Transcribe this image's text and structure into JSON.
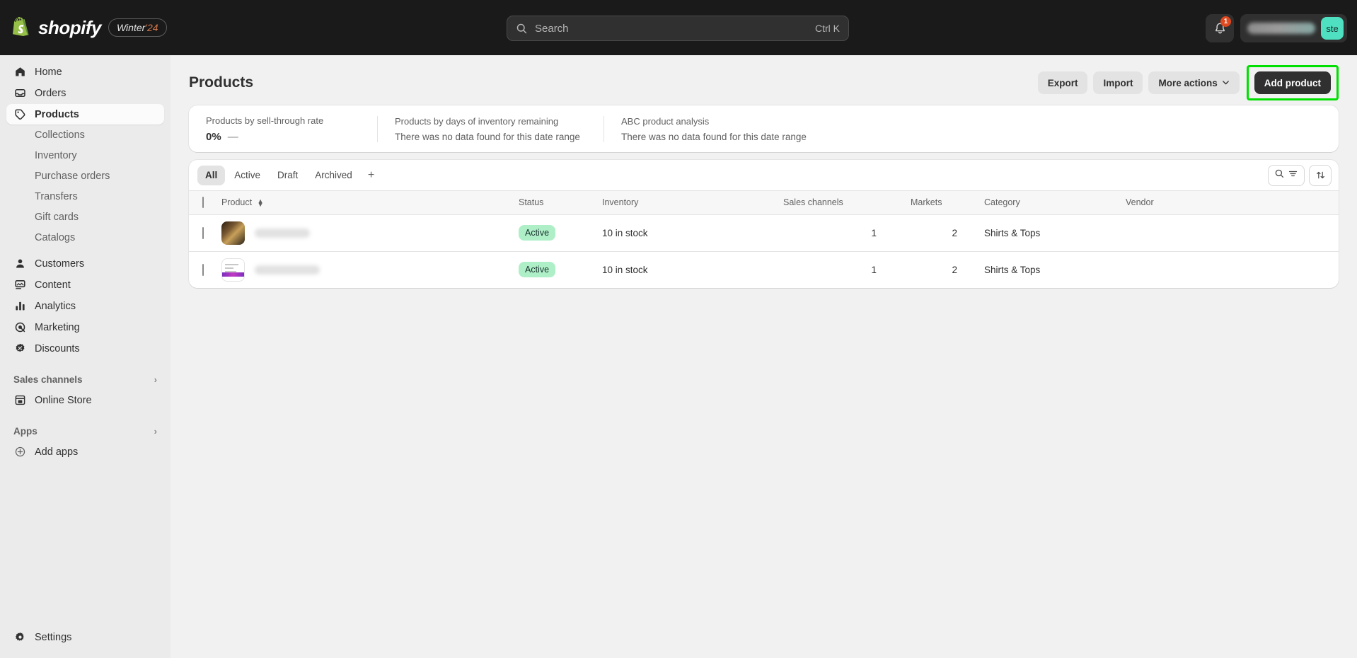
{
  "topbar": {
    "brand_name": "shopify",
    "version_prefix": "Winter ",
    "version_year": "'24",
    "search_placeholder": "Search",
    "search_value": "",
    "shortcut_hint": "Ctrl K",
    "notification_count": "1",
    "store_name": "",
    "avatar_initials": "ste"
  },
  "sidebar": {
    "items": [
      {
        "label": "Home",
        "icon": "home-icon"
      },
      {
        "label": "Orders",
        "icon": "orders-icon"
      },
      {
        "label": "Products",
        "icon": "tag-icon",
        "active": true
      },
      {
        "label": "Customers",
        "icon": "person-icon"
      },
      {
        "label": "Content",
        "icon": "content-icon"
      },
      {
        "label": "Analytics",
        "icon": "bar-chart-icon"
      },
      {
        "label": "Marketing",
        "icon": "target-icon"
      },
      {
        "label": "Discounts",
        "icon": "discount-icon"
      }
    ],
    "sub_items": [
      {
        "label": "Collections"
      },
      {
        "label": "Inventory"
      },
      {
        "label": "Purchase orders"
      },
      {
        "label": "Transfers"
      },
      {
        "label": "Gift cards"
      },
      {
        "label": "Catalogs"
      }
    ],
    "sales_channels_header": "Sales channels",
    "sales_channels": [
      {
        "label": "Online Store",
        "icon": "store-icon"
      }
    ],
    "apps_header": "Apps",
    "apps": [
      {
        "label": "Add apps",
        "icon": "plus-circle-icon"
      }
    ],
    "settings_label": "Settings"
  },
  "page": {
    "title": "Products",
    "export_label": "Export",
    "import_label": "Import",
    "more_actions_label": "More actions",
    "add_product_label": "Add product",
    "highlight_color": "#00e000"
  },
  "metrics": [
    {
      "label": "Products by sell-through rate",
      "value": "0%",
      "delta": "—"
    },
    {
      "label": "Products by days of inventory remaining",
      "empty": "There was no data found for this date range"
    },
    {
      "label": "ABC product analysis",
      "empty": "There was no data found for this date range"
    }
  ],
  "tabs": [
    {
      "label": "All",
      "active": true
    },
    {
      "label": "Active",
      "active": false
    },
    {
      "label": "Draft",
      "active": false
    },
    {
      "label": "Archived",
      "active": false
    }
  ],
  "tab_add_label": "+",
  "table": {
    "columns": [
      "Product",
      "Status",
      "Inventory",
      "Sales channels",
      "Markets",
      "Category",
      "Vendor"
    ],
    "rows": [
      {
        "product_name": "",
        "thumb": "dark-photo",
        "status": "Active",
        "inventory": "10 in stock",
        "sales_channels": "1",
        "markets": "2",
        "category": "Shirts & Tops",
        "vendor": ""
      },
      {
        "product_name": "",
        "thumb": "light-screenshot",
        "status": "Active",
        "inventory": "10 in stock",
        "sales_channels": "1",
        "markets": "2",
        "category": "Shirts & Tops",
        "vendor": ""
      }
    ]
  }
}
